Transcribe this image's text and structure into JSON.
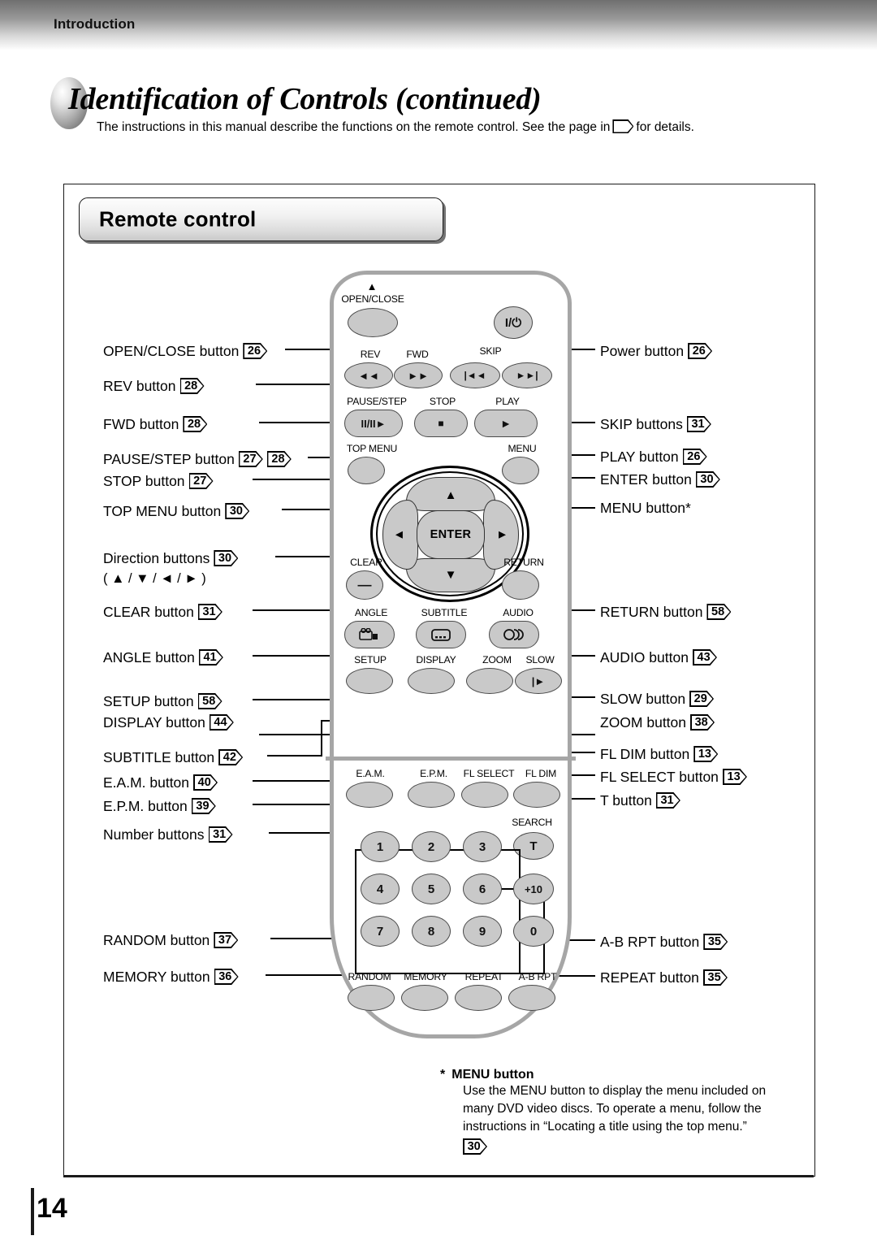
{
  "running_head": "Introduction",
  "page_title": "Identification of Controls (continued)",
  "intro_text_before": "The instructions in this manual describe the functions on the remote control. See the page in",
  "intro_text_after": "for details.",
  "section_tab": "Remote control",
  "page_number": "14",
  "left_labels": [
    {
      "label": "OPEN/CLOSE button",
      "page_refs": [
        "26"
      ]
    },
    {
      "label": "REV button",
      "page_refs": [
        "28"
      ]
    },
    {
      "label": "FWD button",
      "page_refs": [
        "28"
      ]
    },
    {
      "label": "PAUSE/STEP button",
      "page_refs": [
        "27",
        "28"
      ]
    },
    {
      "label": "STOP button",
      "page_refs": [
        "27"
      ]
    },
    {
      "label": "TOP MENU button",
      "page_refs": [
        "30"
      ]
    },
    {
      "label": "Direction buttons",
      "page_refs": [
        "30"
      ],
      "sublabel": "( ▲ / ▼ / ◄ / ► )"
    },
    {
      "label": "CLEAR button",
      "page_refs": [
        "31"
      ]
    },
    {
      "label": "ANGLE button",
      "page_refs": [
        "41"
      ]
    },
    {
      "label": "SETUP button",
      "page_refs": [
        "58"
      ]
    },
    {
      "label": "DISPLAY button",
      "page_refs": [
        "44"
      ]
    },
    {
      "label": "SUBTITLE button",
      "page_refs": [
        "42"
      ]
    },
    {
      "label": "E.A.M. button",
      "page_refs": [
        "40"
      ]
    },
    {
      "label": "E.P.M. button",
      "page_refs": [
        "39"
      ]
    },
    {
      "label": "Number buttons",
      "page_refs": [
        "31"
      ]
    },
    {
      "label": "RANDOM button",
      "page_refs": [
        "37"
      ]
    },
    {
      "label": "MEMORY button",
      "page_refs": [
        "36"
      ]
    }
  ],
  "right_labels": [
    {
      "label": "Power button",
      "page_refs": [
        "26"
      ]
    },
    {
      "label": "SKIP buttons",
      "page_refs": [
        "31"
      ]
    },
    {
      "label": "PLAY button",
      "page_refs": [
        "26"
      ]
    },
    {
      "label": "ENTER button",
      "page_refs": [
        "30"
      ]
    },
    {
      "label": "MENU button*",
      "page_refs": []
    },
    {
      "label": "RETURN button",
      "page_refs": [
        "58"
      ]
    },
    {
      "label": "AUDIO button",
      "page_refs": [
        "43"
      ]
    },
    {
      "label": "SLOW button",
      "page_refs": [
        "29"
      ]
    },
    {
      "label": "ZOOM button",
      "page_refs": [
        "38"
      ]
    },
    {
      "label": "FL DIM button",
      "page_refs": [
        "13"
      ]
    },
    {
      "label": "FL SELECT button",
      "page_refs": [
        "13"
      ]
    },
    {
      "label": "T button",
      "page_refs": [
        "31"
      ]
    },
    {
      "label": "A-B RPT button",
      "page_refs": [
        "35"
      ]
    },
    {
      "label": "REPEAT button",
      "page_refs": [
        "35"
      ]
    }
  ],
  "remote": {
    "captions": {
      "open_close": "OPEN/CLOSE",
      "rev": "REV",
      "fwd": "FWD",
      "skip": "SKIP",
      "pause_step": "PAUSE/STEP",
      "stop": "STOP",
      "play": "PLAY",
      "top_menu": "TOP MENU",
      "menu": "MENU",
      "clear": "CLEAR",
      "return": "RETURN",
      "angle": "ANGLE",
      "subtitle": "SUBTITLE",
      "audio": "AUDIO",
      "setup": "SETUP",
      "display": "DISPLAY",
      "zoom": "ZOOM",
      "slow": "SLOW",
      "eam": "E.A.M.",
      "epm": "E.P.M.",
      "fl_select": "FL SELECT",
      "fl_dim": "FL DIM",
      "search": "SEARCH",
      "random": "RANDOM",
      "memory": "MEMORY",
      "repeat": "REPEAT",
      "ab_rpt": "A-B RPT"
    },
    "glyphs": {
      "eject": "▲",
      "power": "I/⏻",
      "rev": "◄◄",
      "fwd": "►►",
      "skip_prev": "|◄◄",
      "skip_next": "►►|",
      "pause_step": "II/II►",
      "stop": "■",
      "play": "►",
      "slow": "|►",
      "clear": "—",
      "enter": "ENTER",
      "up": "▲",
      "down": "▼",
      "left": "◄",
      "right": "►",
      "angle": "Ἲ5",
      "subtitle": "⬜",
      "audio": "○))",
      "search_t": "T"
    },
    "number_keys": [
      "1",
      "2",
      "3",
      "4",
      "5",
      "6",
      "7",
      "8",
      "9",
      "0",
      "+10"
    ]
  },
  "footnote": {
    "marker": "*",
    "title": "MENU button",
    "lines": [
      "Use the MENU button to display the menu included on",
      "many DVD video discs. To operate a menu, follow the",
      "instructions in “Locating a title using the top menu.”"
    ],
    "page_ref": "30"
  },
  "colors": {
    "button_fill": "#c9c9c9",
    "shell_outline": "#a6a6a6",
    "ink": "#000000"
  }
}
